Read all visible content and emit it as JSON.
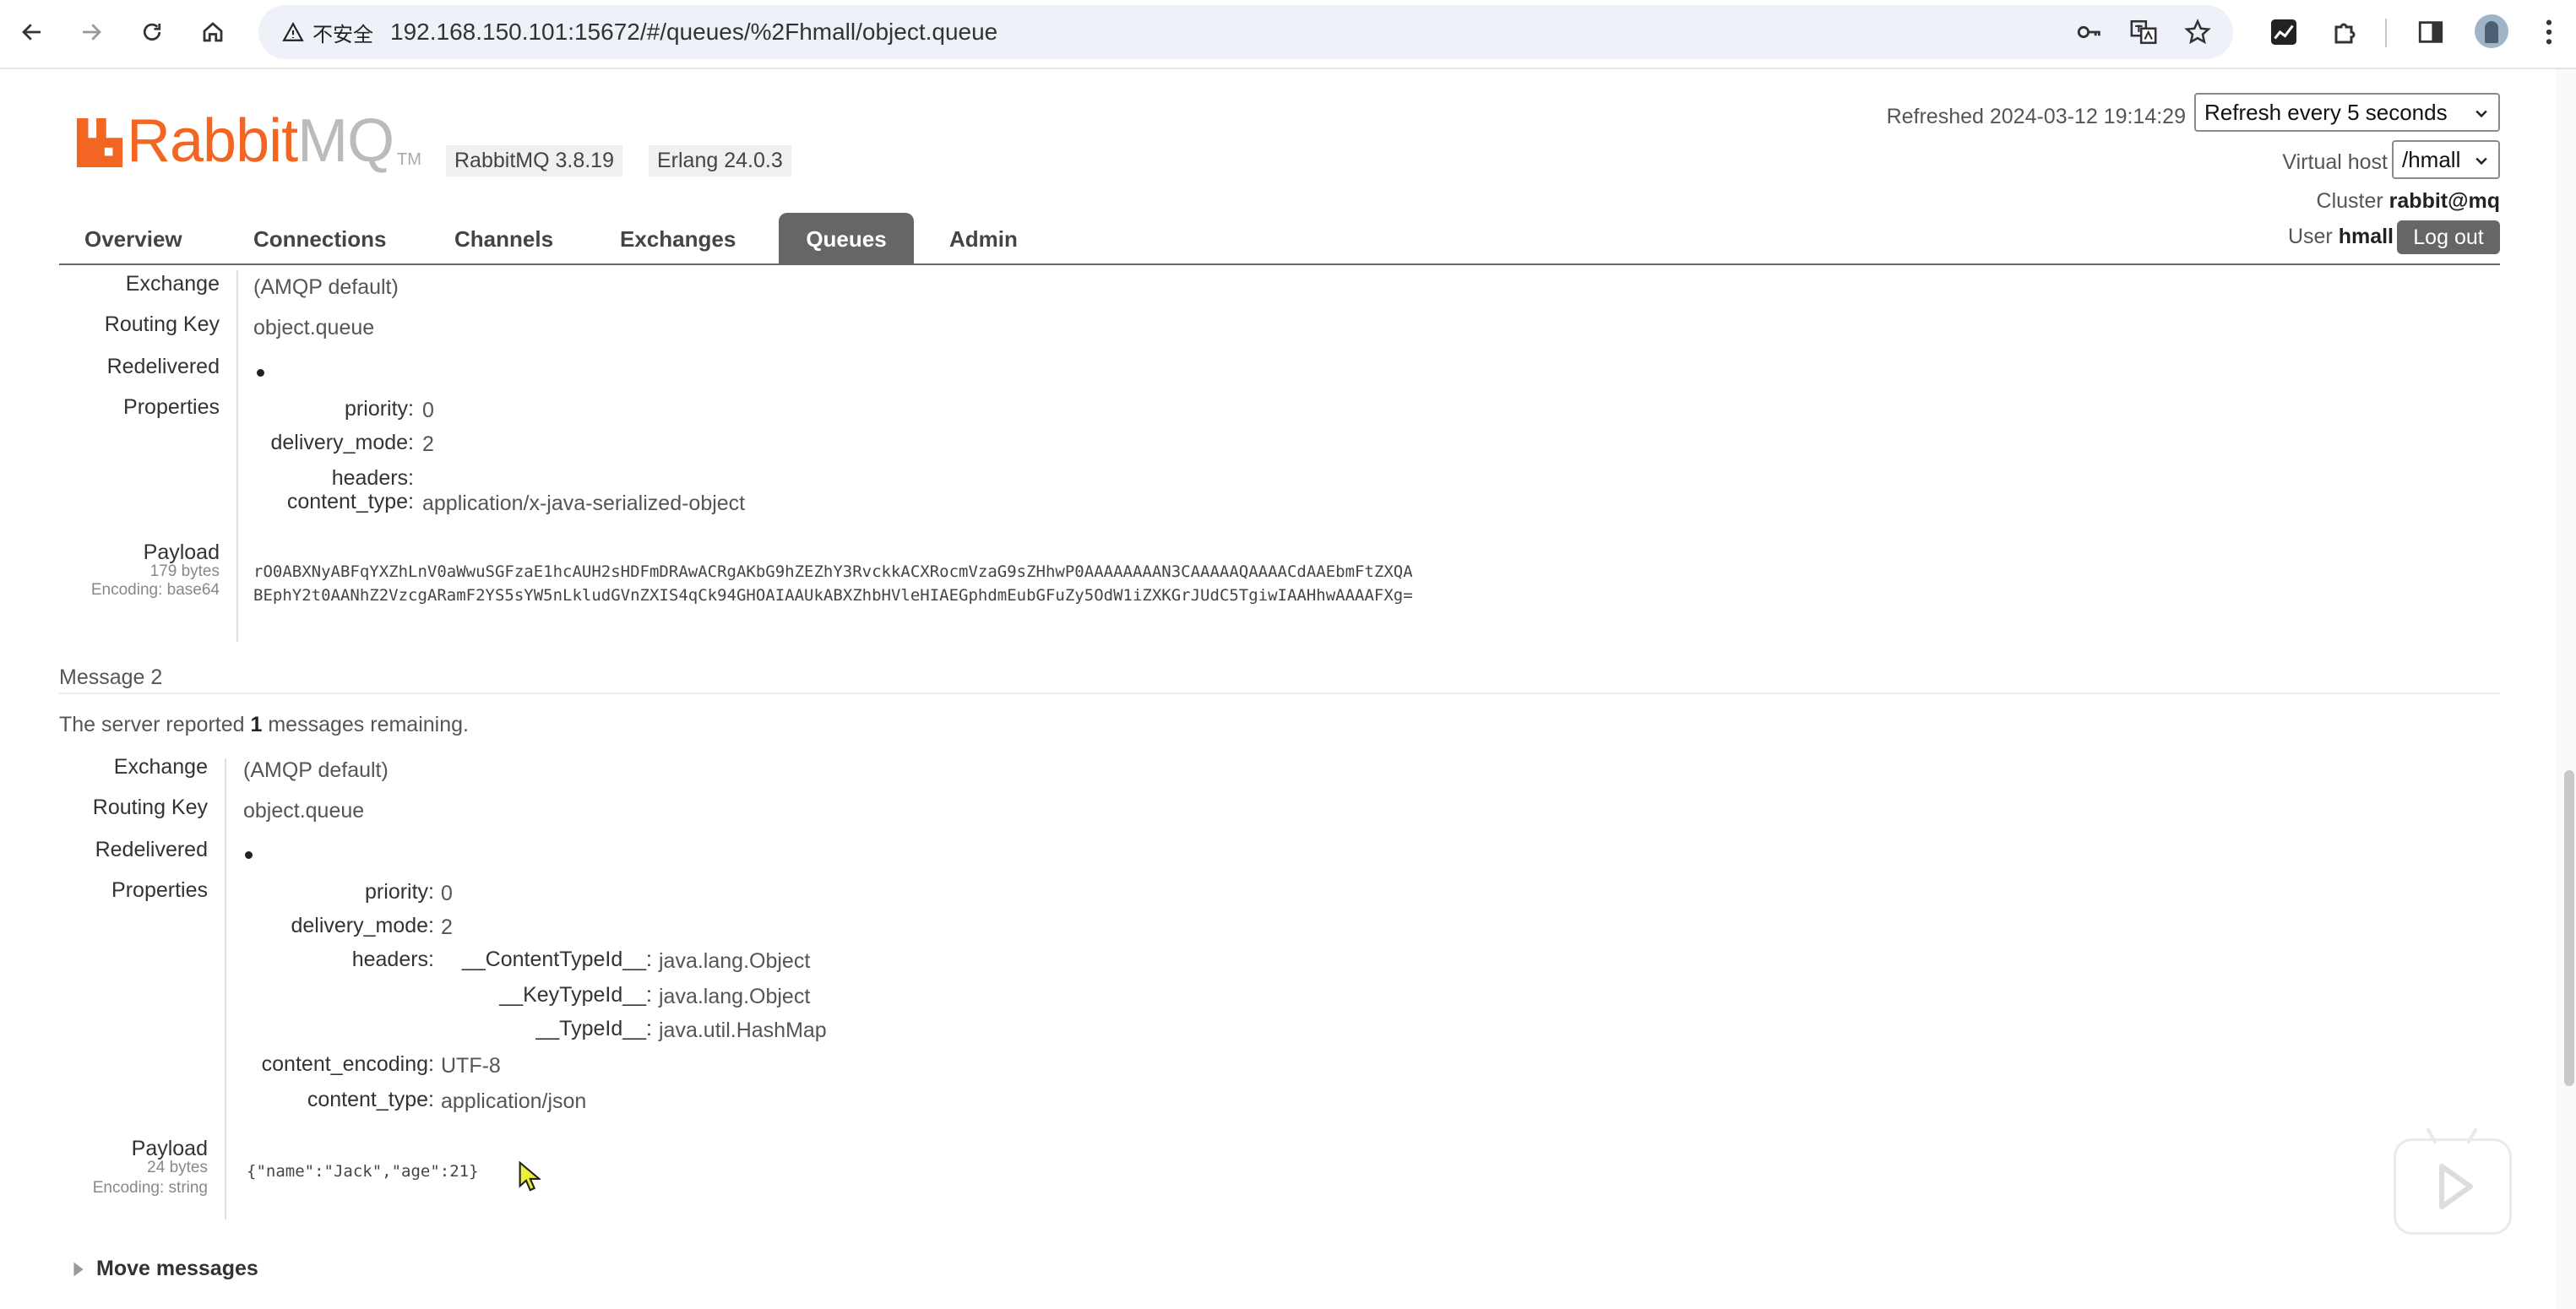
{
  "browser": {
    "security_label": "不安全",
    "url": "192.168.150.101:15672/#/queues/%2Fhmall/object.queue"
  },
  "app": {
    "logo_rabbit": "Rabbit",
    "logo_mq": "MQ",
    "logo_tm": "TM",
    "version": "RabbitMQ 3.8.19",
    "erlang": "Erlang 24.0.3",
    "refreshed_label": "Refreshed 2024-03-12 19:14:29",
    "refresh_select": "Refresh every 5 seconds",
    "virtual_host_label": "Virtual host",
    "virtual_host_value": "/hmall",
    "cluster_label": "Cluster",
    "cluster_value": "rabbit@mq",
    "user_label": "User",
    "user_value": "hmall",
    "logout_label": "Log out"
  },
  "tabs": {
    "overview": "Overview",
    "connections": "Connections",
    "channels": "Channels",
    "exchanges": "Exchanges",
    "queues": "Queues",
    "admin": "Admin",
    "active": "Queues"
  },
  "message1": {
    "exchange_label": "Exchange",
    "exchange": "(AMQP default)",
    "routing_key_label": "Routing Key",
    "routing_key": "object.queue",
    "redelivered_label": "Redelivered",
    "properties_label": "Properties",
    "prop_priority_key": "priority:",
    "prop_priority": "0",
    "prop_delivery_mode_key": "delivery_mode:",
    "prop_delivery_mode": "2",
    "prop_headers_key": "headers:",
    "prop_content_type_key": "content_type:",
    "prop_content_type": "application/x-java-serialized-object",
    "payload_label": "Payload",
    "payload_size": "179 bytes",
    "payload_encoding": "Encoding: base64",
    "payload_line1": "rO0ABXNyABFqYXZhLnV0aWwuSGFzaE1hcAUH2sHDFmDRAwACRgAKbG9hZEZhY3RvckkACXRocmVzaG9sZHhwP0AAAAAAAAN3CAAAAAQAAAACdAAEbmFtZXQA",
    "payload_line2": "BEphY2t0AANhZ2VzcgARamF2YS5sYW5nLkludGVnZXIS4qCk94GHOAIAAUkABXZhbHVleHIAEGphdmEubGFuZy5OdW1iZXKGrJUdC5TgiwIAAHhwAAAAFXg="
  },
  "message2": {
    "title": "Message 2",
    "remaining_prefix": "The server reported",
    "remaining_count": "1",
    "remaining_suffix": "messages remaining.",
    "exchange_label": "Exchange",
    "exchange": "(AMQP default)",
    "routing_key_label": "Routing Key",
    "routing_key": "object.queue",
    "redelivered_label": "Redelivered",
    "properties_label": "Properties",
    "prop_priority_key": "priority:",
    "prop_priority": "0",
    "prop_delivery_mode_key": "delivery_mode:",
    "prop_delivery_mode": "2",
    "prop_headers_key": "headers:",
    "header_content_type_key": "__ContentTypeId__:",
    "header_content_type": "java.lang.Object",
    "header_key_type_key": "__KeyTypeId__:",
    "header_key_type": "java.lang.Object",
    "header_type_key": "__TypeId__:",
    "header_type": "java.util.HashMap",
    "prop_content_encoding_key": "content_encoding:",
    "prop_content_encoding": "UTF-8",
    "prop_content_type_key": "content_type:",
    "prop_content_type": "application/json",
    "payload_label": "Payload",
    "payload_size": "24 bytes",
    "payload_encoding": "Encoding: string",
    "payload": "{\"name\":\"Jack\",\"age\":21}"
  },
  "move_messages": "Move messages",
  "colors": {
    "brand_orange": "#f26522",
    "tab_active": "#666666"
  }
}
